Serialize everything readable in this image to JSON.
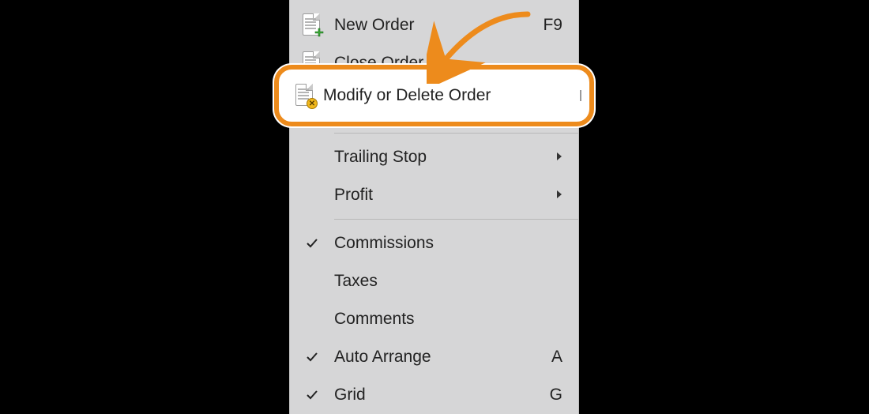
{
  "menu": {
    "newOrder": {
      "label": "New Order",
      "shortcut": "F9"
    },
    "closeOrder": {
      "label": "Close Order"
    },
    "modifyDelete": {
      "label": "Modify or Delete Order"
    },
    "trailingStop": {
      "label": "Trailing Stop"
    },
    "profit": {
      "label": "Profit"
    },
    "commissions": {
      "label": "Commissions"
    },
    "taxes": {
      "label": "Taxes"
    },
    "comments": {
      "label": "Comments"
    },
    "autoArrange": {
      "label": "Auto Arrange",
      "shortcut": "A"
    },
    "grid": {
      "label": "Grid",
      "shortcut": "G"
    }
  },
  "colors": {
    "highlight": "#ed8b1c"
  }
}
